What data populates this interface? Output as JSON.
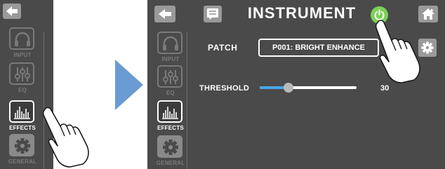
{
  "left_panel": {
    "side_items": [
      {
        "label": "INPUT",
        "icon": "headphones-icon"
      },
      {
        "label": "EQ",
        "icon": "eq-sliders-icon"
      },
      {
        "label": "EFFECTS",
        "icon": "effects-bars-icon"
      },
      {
        "label": "GENERAL",
        "icon": "gear-icon"
      }
    ],
    "active_item": "EFFECTS"
  },
  "right_panel": {
    "title": "INSTRUMENT",
    "power_on": true,
    "side_items": [
      {
        "label": "INPUT"
      },
      {
        "label": "EQ"
      },
      {
        "label": "EFFECTS"
      },
      {
        "label": "GENERAL"
      }
    ],
    "patch": {
      "label": "PATCH",
      "value": "P001: BRIGHT ENHANCE"
    },
    "threshold": {
      "label": "THRESHOLD",
      "value": "30",
      "level": 0.3
    }
  },
  "colors": {
    "panel": "#4a4a4a",
    "button": "#9a9a9a",
    "power": "#7ad155",
    "slider_fill": "#4aa5e6",
    "arrow": "#6a9bd3"
  }
}
